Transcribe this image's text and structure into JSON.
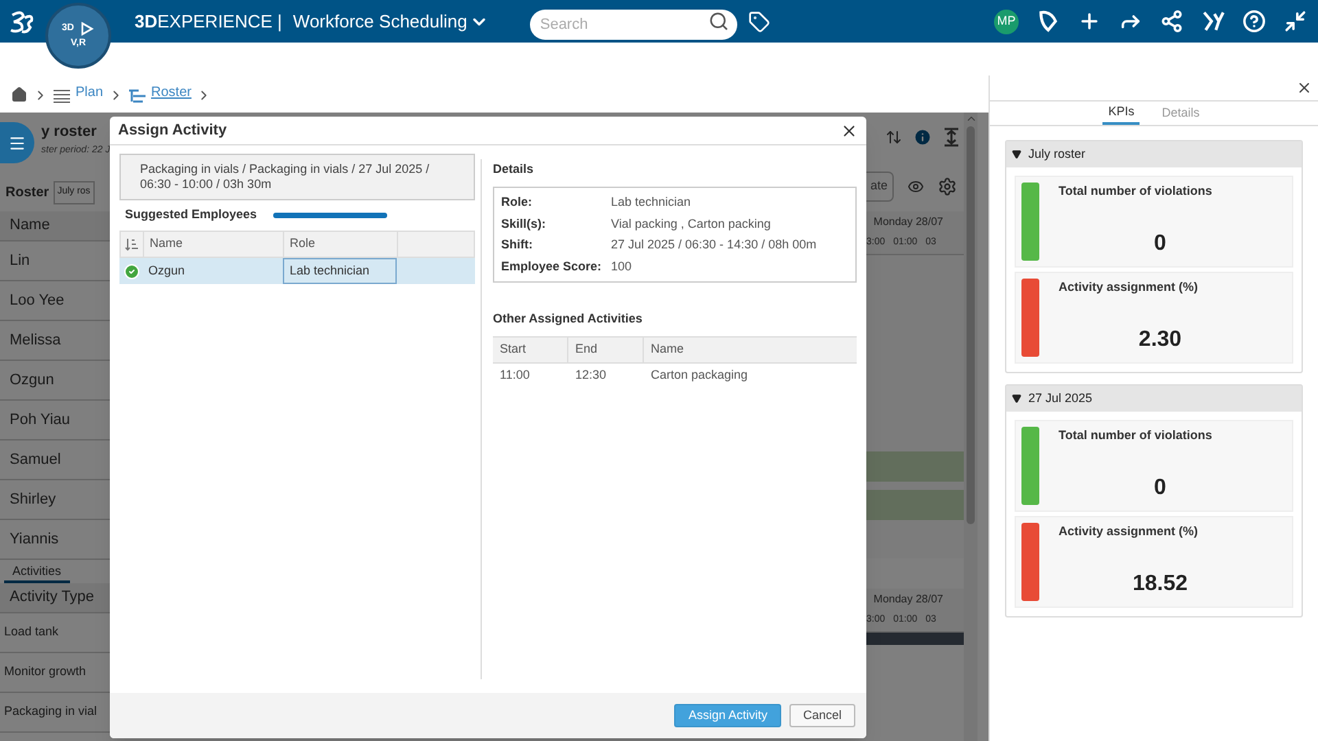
{
  "topbar": {
    "brand": "**3D**EXPERIENCE |",
    "app": "Workforce Scheduling",
    "compass": [
      "3D",
      "V,R"
    ],
    "search": {
      "placeholder": "Search"
    },
    "avatar": "MP"
  },
  "breadcrumb": [
    "Plan",
    "Roster"
  ],
  "background": {
    "title": "y roster",
    "period": "ster period: 22 J",
    "roster_label": "Roster",
    "roster_select": "July ros",
    "name_header": "Name",
    "names": [
      "Lin",
      "Loo Yee",
      "Melissa",
      "Ozgun",
      "Poh Yiau",
      "Samuel",
      "Shirley",
      "Yiannis"
    ],
    "tab": "Activities",
    "activity_header": "Activity Type",
    "activities": [
      "Load tank",
      "Monitor growth",
      "Packaging in vial"
    ],
    "button": "ate",
    "day": "Monday 28/07",
    "times": [
      "3:00",
      "01:00",
      "03"
    ],
    "day_2": "Monday 28/07",
    "times_2": [
      "3:00",
      "01:00",
      "03"
    ]
  },
  "dialog": {
    "title": "Assign Activity",
    "summary": "Packaging in vials / Packaging in vials / 27 Jul 2025 / 06:30 - 10:00 / 03h 30m",
    "suggested_label": "Suggested Employees",
    "progress": {
      "level": 1
    },
    "columns": [
      "Name",
      "Role"
    ],
    "employees": [
      {
        "name": "Ozgun",
        "role": "Lab technician",
        "selected": true,
        "ok": true
      }
    ],
    "details_title": "Details",
    "details": [
      {
        "label": "Role:",
        "value": "Lab technician"
      },
      {
        "label": "Skill(s):",
        "value": "Vial packing , Carton packing"
      },
      {
        "label": "Shift:",
        "value": "27 Jul 2025 / 06:30 - 14:30 / 08h 00m"
      },
      {
        "label": "Employee Score:",
        "value": "100"
      }
    ],
    "other_title": "Other Assigned Activities",
    "other_columns": [
      "Start",
      "End",
      "Name"
    ],
    "other_rows": [
      [
        "11:00",
        "12:30",
        "Carton packaging"
      ]
    ],
    "buttons": [
      {
        "label": "Assign Activity",
        "kind": "primary"
      },
      {
        "label": "Cancel",
        "kind": "secondary"
      }
    ]
  },
  "kpi_panel": {
    "tabs": [
      {
        "label": "KPIs",
        "selected": true
      },
      {
        "label": "Details",
        "selected": false
      }
    ],
    "groups": [
      {
        "title": "July roster",
        "expanded": true,
        "cards": [
          {
            "title": "Total number of violations",
            "value": "0",
            "color": "#56b848"
          },
          {
            "title": "Activity assignment (%)",
            "value": "2.30",
            "color": "#e84b36"
          }
        ]
      },
      {
        "title": "27 Jul 2025",
        "expanded": true,
        "cards": [
          {
            "title": "Total number of violations",
            "value": "0",
            "color": "#56b848"
          },
          {
            "title": "Activity assignment (%)",
            "value": "18.52",
            "color": "#e84b36"
          }
        ]
      }
    ]
  }
}
